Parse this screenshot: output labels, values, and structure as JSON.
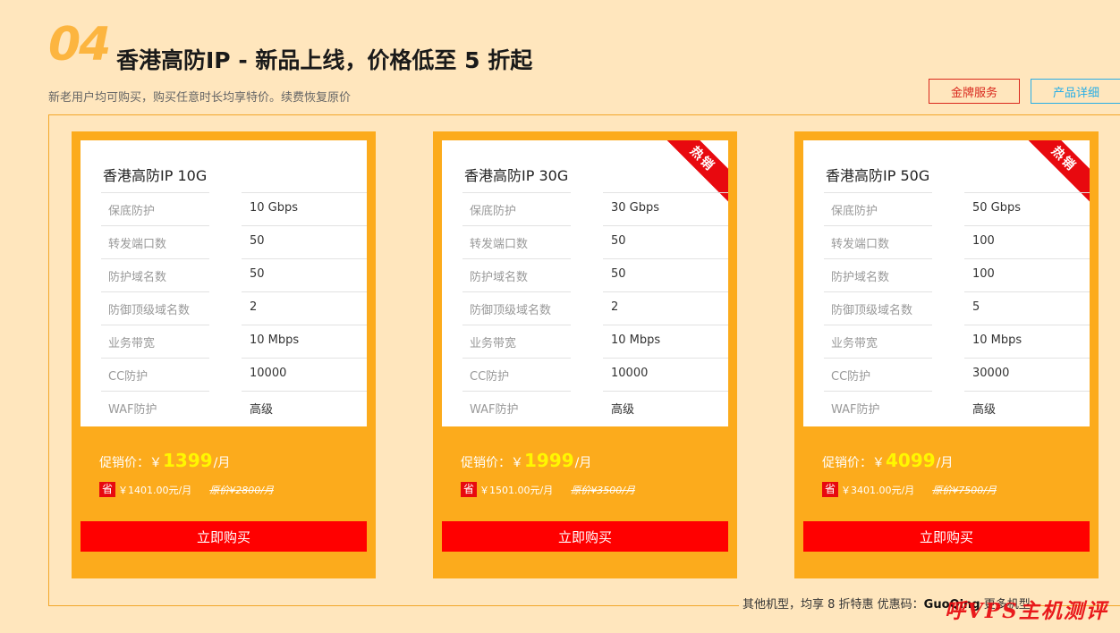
{
  "header": {
    "section_number": "04",
    "title": "香港高防IP - 新品上线，价格低至 5 折起",
    "subtitle": "新老用户均可购买，购买任意时长均享特价。续费恢复原价",
    "brand_button": "金牌服务",
    "detail_button": "产品详细"
  },
  "colors": {
    "background": "#ffe6bd",
    "card": "#fcab1c",
    "buy": "#ff0000",
    "price_highlight": "#fff700",
    "brand_border": "#d9281d",
    "detail_border": "#29aee6"
  },
  "cards": [
    {
      "title": "香港高防IP 10G",
      "hot": "",
      "specs": [
        {
          "label": "保底防护",
          "value": "10 Gbps"
        },
        {
          "label": "转发端口数",
          "value": "50"
        },
        {
          "label": "防护域名数",
          "value": "50"
        },
        {
          "label": "防御顶级域名数",
          "value": "2"
        },
        {
          "label": "业务带宽",
          "value": "10 Mbps"
        },
        {
          "label": "CC防护",
          "value": "10000"
        },
        {
          "label": "WAF防护",
          "value": "高级"
        }
      ],
      "price_label": "促销价：￥",
      "price": "1399",
      "unit": "/月",
      "save_badge": "省",
      "save": "￥1401.00元/月",
      "original": "原价¥2800/月",
      "buy_label": "立即购买"
    },
    {
      "title": "香港高防IP 30G",
      "hot": "热销",
      "specs": [
        {
          "label": "保底防护",
          "value": "30 Gbps"
        },
        {
          "label": "转发端口数",
          "value": "50"
        },
        {
          "label": "防护域名数",
          "value": "50"
        },
        {
          "label": "防御顶级域名数",
          "value": "2"
        },
        {
          "label": "业务带宽",
          "value": "10 Mbps"
        },
        {
          "label": "CC防护",
          "value": "10000"
        },
        {
          "label": "WAF防护",
          "value": "高级"
        }
      ],
      "price_label": "促销价：￥",
      "price": "1999",
      "unit": "/月",
      "save_badge": "省",
      "save": "￥1501.00元/月",
      "original": "原价¥3500/月",
      "buy_label": "立即购买"
    },
    {
      "title": "香港高防IP 50G",
      "hot": "热销",
      "specs": [
        {
          "label": "保底防护",
          "value": "50 Gbps"
        },
        {
          "label": "转发端口数",
          "value": "100"
        },
        {
          "label": "防护域名数",
          "value": "100"
        },
        {
          "label": "防御顶级域名数",
          "value": "5"
        },
        {
          "label": "业务带宽",
          "value": "10 Mbps"
        },
        {
          "label": "CC防护",
          "value": "30000"
        },
        {
          "label": "WAF防护",
          "value": "高级"
        }
      ],
      "price_label": "促销价：￥",
      "price": "4099",
      "unit": "/月",
      "save_badge": "省",
      "save": "￥3401.00元/月",
      "original": "原价¥7500/月",
      "buy_label": "立即购买"
    }
  ],
  "footer": {
    "note": "其他机型，均享 8 折特惠 优惠码：",
    "code": "GuoQing",
    "more": "更多机型",
    "watermark": "呼VPS主机测评"
  }
}
